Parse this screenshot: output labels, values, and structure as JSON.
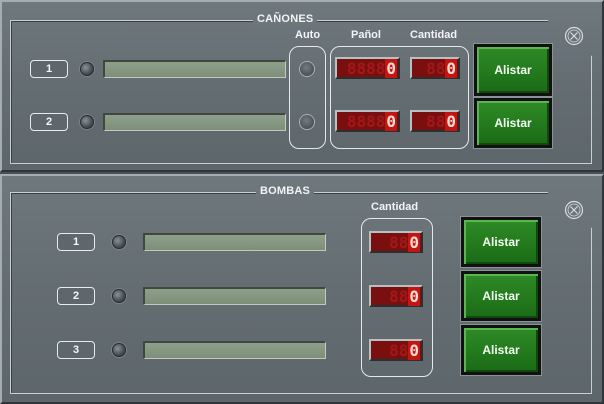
{
  "canones": {
    "title": "CAÑONES",
    "col_auto": "Auto",
    "col_panol": "Pañol",
    "col_cantidad": "Cantidad",
    "rows": [
      {
        "number": "1",
        "panol": "0",
        "cantidad": "0",
        "button": "Alistar"
      },
      {
        "number": "2",
        "panol": "0",
        "cantidad": "0",
        "button": "Alistar"
      }
    ],
    "close_icon": "close-circle-icon"
  },
  "bombas": {
    "title": "BOMBAS",
    "col_cantidad": "Cantidad",
    "rows": [
      {
        "number": "1",
        "cantidad": "0",
        "button": "Alistar"
      },
      {
        "number": "2",
        "cantidad": "0",
        "button": "Alistar"
      },
      {
        "number": "3",
        "cantidad": "0",
        "button": "Alistar"
      }
    ],
    "close_icon": "close-circle-icon"
  },
  "colors": {
    "panel": "#646d71",
    "button_green": "#237a1d",
    "display_red": "#c41610"
  }
}
